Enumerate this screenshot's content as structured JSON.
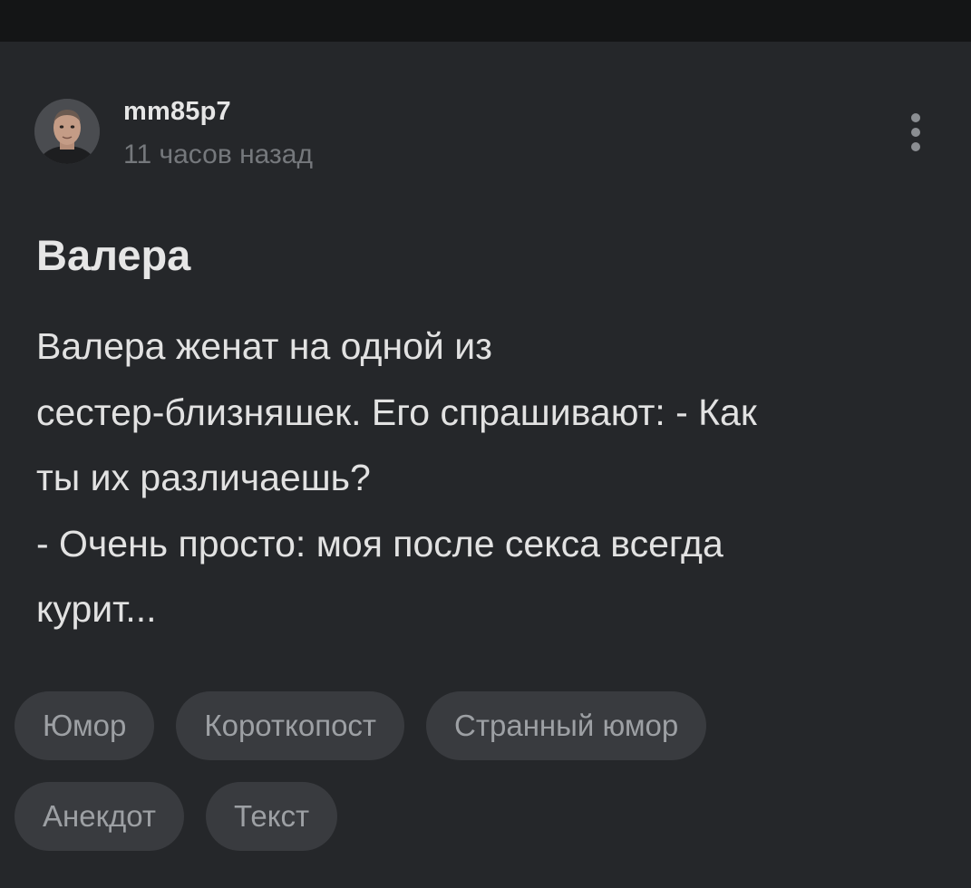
{
  "post": {
    "author": {
      "username": "mm85p7",
      "time_ago": "11 часов назад",
      "avatar_icon": "user-photo-avatar"
    },
    "menu_icon": "more-vertical-icon",
    "title": "Валера",
    "body_lines": [
      "Валера женат на одной из",
      "сестер-близняшек. Его спрашивают: - Как",
      "ты их различаешь?",
      "- Очень просто: моя после секса всегда",
      "курит..."
    ],
    "tags": [
      "Юмор",
      "Коротко­пост",
      "Странный юмор",
      "Анекдот",
      "Текст"
    ]
  },
  "colors": {
    "background": "#25272a",
    "top_strip": "#141516",
    "tag_background": "#393b3f",
    "tag_text": "#9da0a4",
    "muted_text": "#75787c"
  }
}
